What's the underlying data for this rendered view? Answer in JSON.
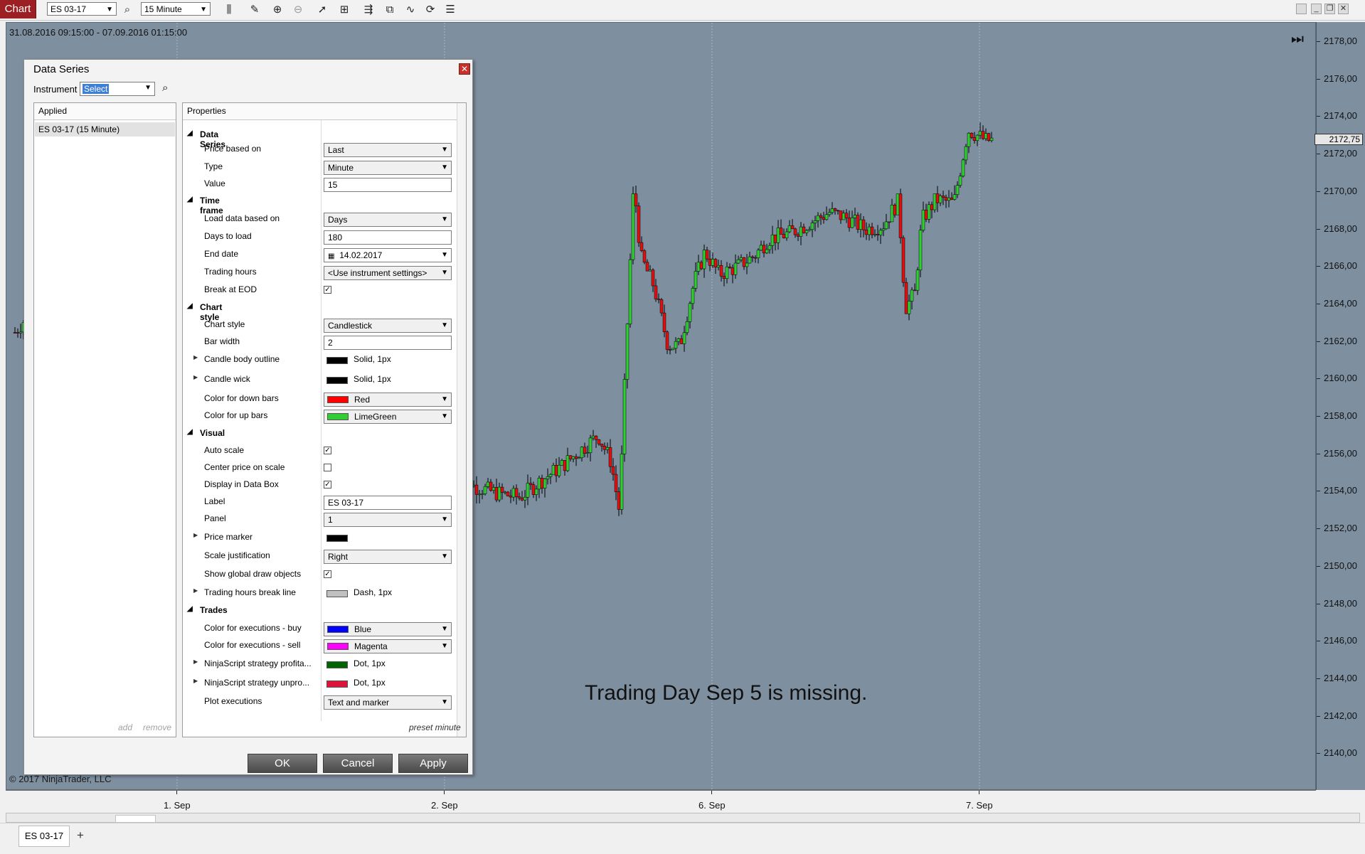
{
  "toolbar": {
    "app_label": "Chart",
    "instrument": "ES 03-17",
    "interval": "15 Minute"
  },
  "chart": {
    "date_range": "31.08.2016 09:15:00 - 07.09.2016 01:15:00",
    "copyright": "© 2017 NinjaTrader, LLC",
    "annotation": "Trading Day Sep 5 is missing.",
    "last_price": "2172,75",
    "price_ticks": [
      "2178,00",
      "2176,00",
      "2174,00",
      "2172,00",
      "2170,00",
      "2168,00",
      "2166,00",
      "2164,00",
      "2162,00",
      "2160,00",
      "2158,00",
      "2156,00",
      "2154,00",
      "2152,00",
      "2150,00",
      "2148,00",
      "2146,00",
      "2144,00",
      "2142,00",
      "2140,00"
    ],
    "time_ticks": [
      "1. Sep",
      "2. Sep",
      "6. Sep",
      "7. Sep"
    ],
    "colors": {
      "background": "#7e8fa0",
      "up": "#32cd32",
      "down": "#e01010",
      "wick": "#000000"
    }
  },
  "tabs": {
    "active": "ES 03-17",
    "add": "+"
  },
  "dialog": {
    "title": "Data Series",
    "close": "✕",
    "instrument_label": "Instrument",
    "instrument_value": "Select",
    "applied_header": "Applied",
    "applied_item": "ES 03-17 (15 Minute)",
    "add": "add",
    "remove": "remove",
    "properties_header": "Properties",
    "preset": "preset minute",
    "buttons": {
      "ok": "OK",
      "cancel": "Cancel",
      "apply": "Apply"
    },
    "sections": {
      "data_series": "Data Series",
      "time_frame": "Time frame",
      "chart_style": "Chart style",
      "visual": "Visual",
      "trades": "Trades"
    },
    "props": {
      "price_based_on": {
        "label": "Price based on",
        "value": "Last"
      },
      "type": {
        "label": "Type",
        "value": "Minute"
      },
      "value": {
        "label": "Value",
        "value": "15"
      },
      "load_data_based_on": {
        "label": "Load data based on",
        "value": "Days"
      },
      "days_to_load": {
        "label": "Days to load",
        "value": "180"
      },
      "end_date": {
        "label": "End date",
        "value": "14.02.2017"
      },
      "trading_hours": {
        "label": "Trading hours",
        "value": "<Use instrument settings>"
      },
      "break_at_eod": {
        "label": "Break at EOD",
        "checked": true
      },
      "chart_style": {
        "label": "Chart style",
        "value": "Candlestick"
      },
      "bar_width": {
        "label": "Bar width",
        "value": "2"
      },
      "candle_body_outline": {
        "label": "Candle body outline",
        "value": "Solid, 1px",
        "color": "#000000"
      },
      "candle_wick": {
        "label": "Candle wick",
        "value": "Solid, 1px",
        "color": "#000000"
      },
      "color_down_bars": {
        "label": "Color for down bars",
        "value": "Red",
        "color": "#ff0000"
      },
      "color_up_bars": {
        "label": "Color for up bars",
        "value": "LimeGreen",
        "color": "#32cd32"
      },
      "auto_scale": {
        "label": "Auto scale",
        "checked": true
      },
      "center_price": {
        "label": "Center price on scale",
        "checked": false
      },
      "display_in_data_box": {
        "label": "Display in Data Box",
        "checked": true
      },
      "label": {
        "label": "Label",
        "value": "ES 03-17"
      },
      "panel": {
        "label": "Panel",
        "value": "1"
      },
      "price_marker": {
        "label": "Price marker",
        "color": "#000000"
      },
      "scale_justification": {
        "label": "Scale justification",
        "value": "Right"
      },
      "show_global_draw_objects": {
        "label": "Show global draw objects",
        "checked": true
      },
      "trading_hours_break_line": {
        "label": "Trading hours break line",
        "value": "Dash, 1px",
        "color": "#c0c0c0"
      },
      "exec_buy": {
        "label": "Color for executions - buy",
        "value": "Blue",
        "color": "#0000ff"
      },
      "exec_sell": {
        "label": "Color for executions - sell",
        "value": "Magenta",
        "color": "#ff00ff"
      },
      "strategy_profit": {
        "label": "NinjaScript strategy profita...",
        "value": "Dot, 1px",
        "color": "#006400"
      },
      "strategy_unprofit": {
        "label": "NinjaScript strategy unpro...",
        "value": "Dot, 1px",
        "color": "#dc143c"
      },
      "plot_executions": {
        "label": "Plot executions",
        "value": "Text and marker"
      }
    }
  }
}
